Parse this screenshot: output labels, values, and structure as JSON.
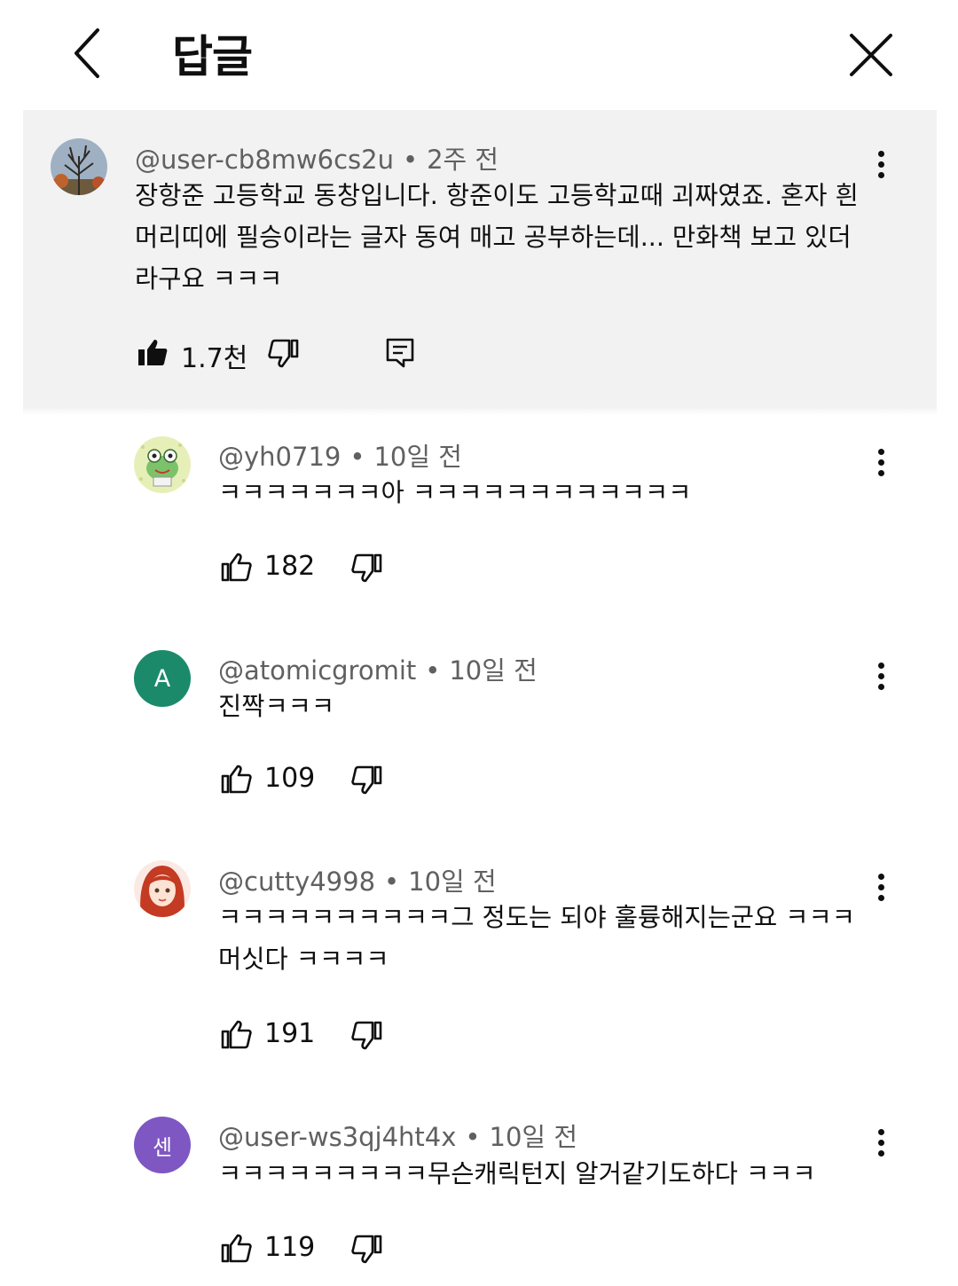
{
  "header": {
    "title": "답글"
  },
  "parent_comment": {
    "author": "@user-cb8mw6cs2u",
    "time": "2주 전",
    "text": "장항준 고등학교 동창입니다. 항준이도 고등학교때 괴짜였죠. 혼자 흰 머리띠에 필승이라는 글자 동여 매고 공부하는데... 만화책 보고 있더라구요 ㅋㅋㅋ",
    "likes": "1.7천",
    "liked": true
  },
  "replies": [
    {
      "author": "@yh0719",
      "time": "10일 전",
      "text": "ㅋㅋㅋㅋㅋㅋㅋ아 ㅋㅋㅋㅋㅋㅋㅋㅋㅋㅋㅋㅋ",
      "likes": "182",
      "avatar_icon": "frog-character-icon"
    },
    {
      "author": "@atomicgromit",
      "time": "10일 전",
      "text": "진짝ㅋㅋㅋ",
      "likes": "109",
      "avatar_letter": "A",
      "avatar_color": "#1b8a6b"
    },
    {
      "author": "@cutty4998",
      "time": "10일 전",
      "text": "ㅋㅋㅋㅋㅋㅋㅋㅋㅋㅋ그 정도는 되야 훌륭해지는군요 ㅋㅋㅋ 머싯다 ㅋㅋㅋㅋ",
      "likes": "191",
      "avatar_icon": "red-hair-girl-icon"
    },
    {
      "author": "@user-ws3qj4ht4x",
      "time": "10일 전",
      "text": "ㅋㅋㅋㅋㅋㅋㅋㅋㅋ무슨캐릭턴지 알거같기도하다 ㅋㅋㅋ",
      "likes": "119",
      "avatar_letter": "센",
      "avatar_color": "#7e57c2"
    }
  ],
  "colors": {
    "parent_background": "#f2f2f2",
    "meta_text": "#606060",
    "primary_text": "#0f0f0f"
  }
}
